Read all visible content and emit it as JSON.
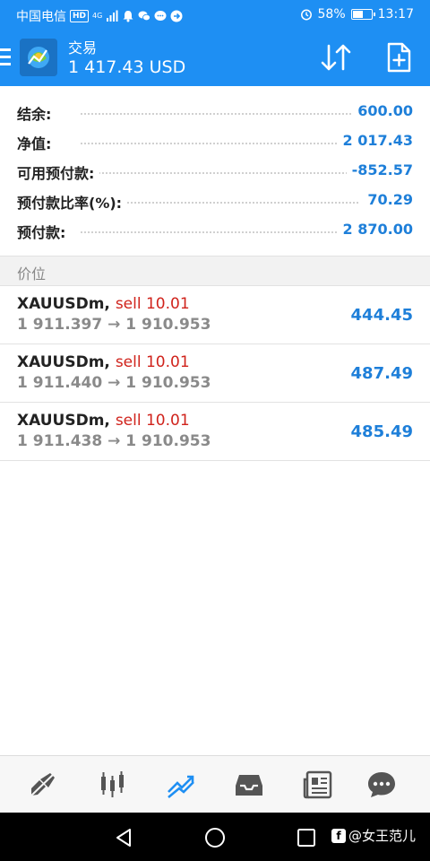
{
  "status_bar": {
    "carrier": "中国电信",
    "hd_badge": "HD",
    "network": "4G",
    "battery": "58%",
    "battery_level": 0.58,
    "time": "13:17"
  },
  "app_bar": {
    "title": "交易",
    "balance_line": "1 417.43 USD",
    "icons": [
      "menu-icon",
      "metatrader-logo",
      "sort-icon",
      "add-order-icon"
    ]
  },
  "summary": [
    {
      "label": "结余:",
      "value": "600.00"
    },
    {
      "label": "净值:",
      "value": "2 017.43"
    },
    {
      "label": "可用预付款:",
      "value": "-852.57"
    },
    {
      "label": "预付款比率(%):",
      "value": "70.29"
    },
    {
      "label": "预付款:",
      "value": "2 870.00"
    }
  ],
  "positions_header": "价位",
  "positions": [
    {
      "symbol": "XAUUSDm",
      "comma": ",",
      "side": "sell 10.01",
      "open": "1 911.397",
      "arrow": "→",
      "current": "1 910.953",
      "profit": "444.45"
    },
    {
      "symbol": "XAUUSDm",
      "comma": ",",
      "side": "sell 10.01",
      "open": "1 911.440",
      "arrow": "→",
      "current": "1 910.953",
      "profit": "487.49"
    },
    {
      "symbol": "XAUUSDm",
      "comma": ",",
      "side": "sell 10.01",
      "open": "1 911.438",
      "arrow": "→",
      "current": "1 910.953",
      "profit": "485.49"
    }
  ],
  "tab_bar": {
    "tabs": [
      "quotes-icon",
      "chart-icon",
      "trade-icon",
      "history-icon",
      "news-icon",
      "chat-icon"
    ],
    "active_index": 2,
    "active_color": "#1e8ff3",
    "inactive_color": "#555555"
  },
  "nav_bar": {
    "buttons": [
      "back-icon",
      "home-icon",
      "recents-icon"
    ],
    "watermark": "@女王范儿"
  },
  "colors": {
    "brand": "#1e8ff3",
    "value_blue": "#1e7fd9",
    "sell_red": "#d0231c"
  }
}
